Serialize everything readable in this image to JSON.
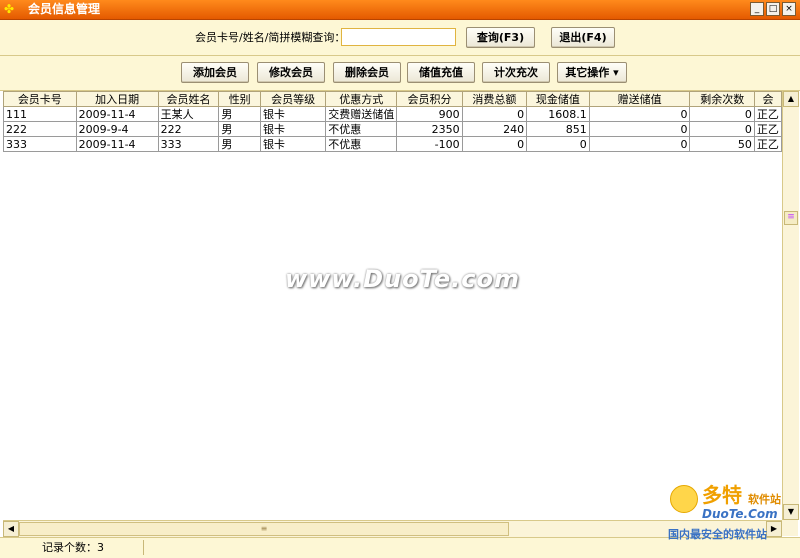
{
  "window": {
    "title": "会员信息管理",
    "controls": {
      "minimize": "_",
      "maximize": "□",
      "close": "×"
    }
  },
  "search": {
    "label": "会员卡号/姓名/简拼模糊查询：",
    "value": "",
    "query_button": "查询(F3)",
    "exit_button": "退出(F4)"
  },
  "toolbar": {
    "add": "添加会员",
    "edit": "修改会员",
    "delete": "删除会员",
    "recharge": "储值充值",
    "count_recharge": "计次充次",
    "other": "其它操作 ▾"
  },
  "table": {
    "columns": [
      "会员卡号",
      "加入日期",
      "会员姓名",
      "性别",
      "会员等级",
      "优惠方式",
      "会员积分",
      "消费总额",
      "现金储值",
      "赠送储值",
      "剩余次数",
      "会"
    ],
    "rows": [
      [
        "111",
        "2009-11-4",
        "王某人",
        "男",
        "银卡",
        "交费赠送储值",
        "900",
        "0",
        "1608.1",
        "0",
        "0",
        "正乙"
      ],
      [
        "222",
        "2009-9-4",
        "222",
        "男",
        "银卡",
        "不优惠",
        "2350",
        "240",
        "851",
        "0",
        "0",
        "正乙"
      ],
      [
        "333",
        "2009-11-4",
        "333",
        "男",
        "银卡",
        "不优惠",
        "-100",
        "0",
        "0",
        "0",
        "50",
        "正乙"
      ]
    ]
  },
  "status": {
    "record_count": "记录个数：3"
  },
  "watermark": {
    "center": "www.DuoTe.com",
    "logo": "多特",
    "logo_sub": "软件站",
    "logo_url": "DuoTe.Com",
    "logo_tag": "国内最安全的软件站"
  },
  "icons": {
    "app": "app-logo-icon",
    "scroll_up": "▲",
    "scroll_down": "▼",
    "scroll_left": "◀",
    "scroll_right": "▶",
    "grip": "≡"
  },
  "colors": {
    "titlebar": "#f07010",
    "panel": "#fdf7d5",
    "accent": "#e0b440"
  }
}
